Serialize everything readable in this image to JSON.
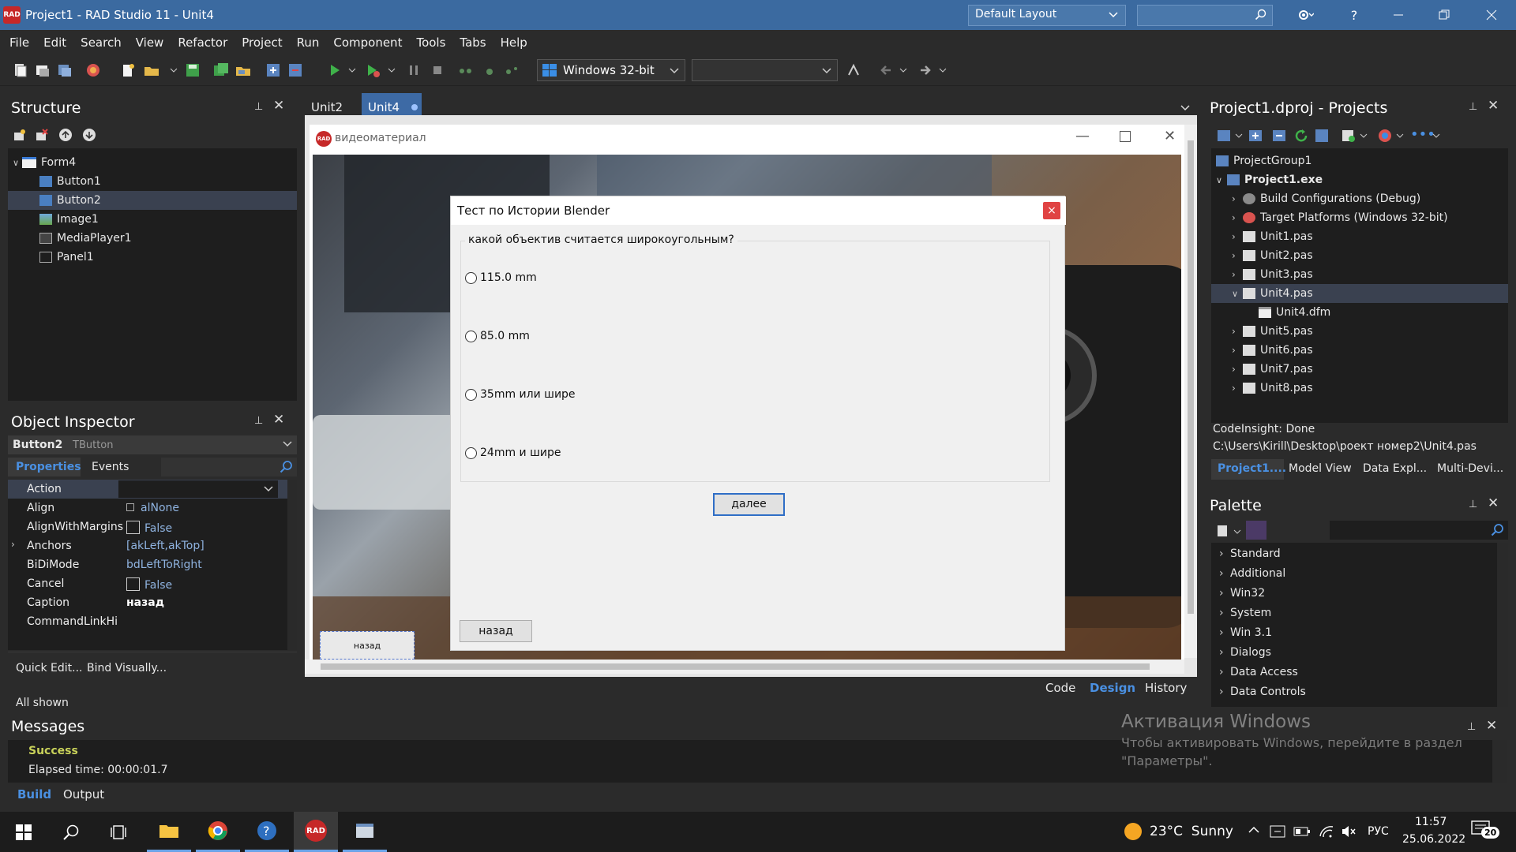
{
  "window": {
    "title": "Project1 - RAD Studio 11 - Unit4",
    "logo_text": "RAD",
    "layout_select": "Default Layout"
  },
  "menu": [
    "File",
    "Edit",
    "Search",
    "View",
    "Refactor",
    "Project",
    "Run",
    "Component",
    "Tools",
    "Tabs",
    "Help"
  ],
  "toolbar": {
    "platform": "Windows 32-bit"
  },
  "structure": {
    "title": "Structure",
    "items": [
      "Form4",
      "Button1",
      "Button2",
      "Image1",
      "MediaPlayer1",
      "Panel1"
    ]
  },
  "object_inspector": {
    "title": "Object Inspector",
    "component": "Button2",
    "component_type": "TButton",
    "tabs": [
      "Properties",
      "Events"
    ],
    "rows": [
      {
        "key": "Action",
        "value": ""
      },
      {
        "key": "Align",
        "value": "alNone"
      },
      {
        "key": "AlignWithMargins",
        "value": "False"
      },
      {
        "key": "Anchors",
        "value": "[akLeft,akTop]"
      },
      {
        "key": "BiDiMode",
        "value": "bdLeftToRight"
      },
      {
        "key": "Cancel",
        "value": "False"
      },
      {
        "key": "Caption",
        "value": "назад"
      },
      {
        "key": "CommandLinkHint",
        "value": ""
      }
    ],
    "quick_edit": "Quick Edit...",
    "bind_visually": "Bind Visually...",
    "all_shown": "All shown"
  },
  "editor": {
    "tabs": [
      "Unit2",
      "Unit4"
    ],
    "form_caption": "видеоматериал",
    "bottom_tabs": [
      "Code",
      "Design",
      "History"
    ]
  },
  "dialog": {
    "title": "Тест по Истории Blender",
    "close": "×",
    "question": "какой объектив считается широкоугольным?",
    "options": [
      "115.0 mm",
      "85.0 mm",
      "35mm или шире",
      "24mm и шире"
    ],
    "next": "далее",
    "back": "назад"
  },
  "form_button_caption": "назад",
  "projects": {
    "title": "Project1.dproj - Projects",
    "items": [
      "ProjectGroup1",
      "Project1.exe",
      "Build Configurations (Debug)",
      "Target Platforms (Windows 32-bit)",
      "Unit1.pas",
      "Unit2.pas",
      "Unit3.pas",
      "Unit4.pas",
      "Unit4.dfm",
      "Unit5.pas",
      "Unit6.pas",
      "Unit7.pas",
      "Unit8.pas"
    ],
    "status1": "CodeInsight: Done",
    "status2": "C:\\Users\\Kirill\\Desktop\\роект номер2\\Unit4.pas",
    "tabs": [
      "Project1....",
      "Model View",
      "Data Expl...",
      "Multi-Devi..."
    ]
  },
  "palette": {
    "title": "Palette",
    "items": [
      "Standard",
      "Additional",
      "Win32",
      "System",
      "Win 3.1",
      "Dialogs",
      "Data Access",
      "Data Controls"
    ]
  },
  "messages": {
    "title": "Messages",
    "success": "Success",
    "elapsed": "Elapsed time: 00:00:01.7",
    "tabs": [
      "Build",
      "Output"
    ]
  },
  "watermark": {
    "title": "Активация Windows",
    "line1": "Чтобы активировать Windows, перейдите в раздел",
    "line2": "\"Параметры\"."
  },
  "taskbar": {
    "weather": "23°C  Sunny",
    "lang": "РУС",
    "time": "11:57",
    "date": "25.06.2022",
    "notifications": "20",
    "rad_label": "RAD"
  },
  "colors": {
    "titlebar": "#3b6aa0",
    "accent": "#4a90e2",
    "success": "#c9d25a",
    "dialog_close": "#e04343"
  }
}
